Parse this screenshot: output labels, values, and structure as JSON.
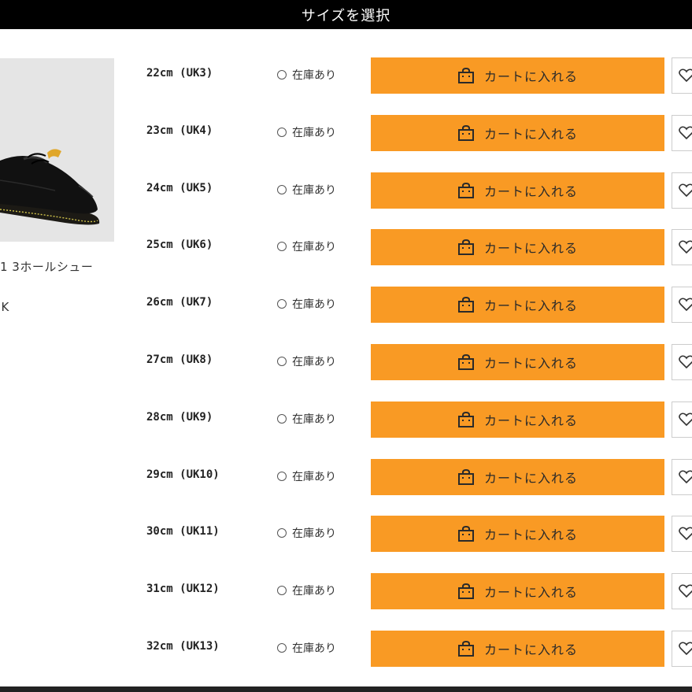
{
  "header": {
    "title": "サイズを選択"
  },
  "product": {
    "name": "1 3ホールシュー",
    "color": "CK"
  },
  "theme": {
    "cart_button_color": "#f99a24",
    "header_color": "#000000"
  },
  "sizes": [
    {
      "label": "22cm (UK3)",
      "stock": "在庫あり",
      "cart_label": "カートに入れる"
    },
    {
      "label": "23cm (UK4)",
      "stock": "在庫あり",
      "cart_label": "カートに入れる"
    },
    {
      "label": "24cm (UK5)",
      "stock": "在庫あり",
      "cart_label": "カートに入れる"
    },
    {
      "label": "25cm (UK6)",
      "stock": "在庫あり",
      "cart_label": "カートに入れる"
    },
    {
      "label": "26cm (UK7)",
      "stock": "在庫あり",
      "cart_label": "カートに入れる"
    },
    {
      "label": "27cm (UK8)",
      "stock": "在庫あり",
      "cart_label": "カートに入れる"
    },
    {
      "label": "28cm (UK9)",
      "stock": "在庫あり",
      "cart_label": "カートに入れる"
    },
    {
      "label": "29cm (UK10)",
      "stock": "在庫あり",
      "cart_label": "カートに入れる"
    },
    {
      "label": "30cm (UK11)",
      "stock": "在庫あり",
      "cart_label": "カートに入れる"
    },
    {
      "label": "31cm (UK12)",
      "stock": "在庫あり",
      "cart_label": "カートに入れる"
    },
    {
      "label": "32cm (UK13)",
      "stock": "在庫あり",
      "cart_label": "カートに入れる"
    }
  ],
  "icons": {
    "cart": "shopping-bag-icon",
    "favorite": "heart-icon",
    "stock": "circle-icon"
  }
}
